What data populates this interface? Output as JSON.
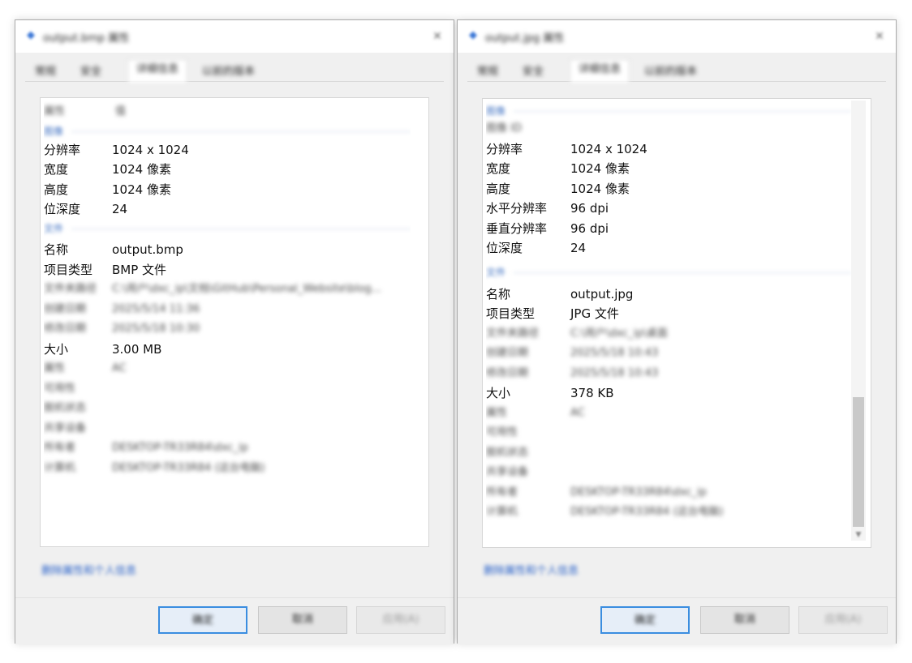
{
  "left": {
    "title": "output.bmp 属性",
    "tabs": [
      "常规",
      "安全",
      "详细信息",
      "以前的版本"
    ],
    "active_tab": 2,
    "header": {
      "key": "属性",
      "value": "值"
    },
    "section_image": "图像",
    "resolution": {
      "key": "分辨率",
      "value": "1024 x 1024"
    },
    "width": {
      "key": "宽度",
      "value": "1024 像素"
    },
    "height": {
      "key": "高度",
      "value": "1024 像素"
    },
    "bit_depth": {
      "key": "位深度",
      "value": "24"
    },
    "section_file": "文件",
    "name": {
      "key": "名称",
      "value": "output.bmp"
    },
    "item_type": {
      "key": "项目类型",
      "value": "BMP 文件"
    },
    "folder_path": {
      "key": "文件夹路径",
      "value": "C:\\用户\\dxc_ip\\文档\\GitHub\\Personal_Website\\blog..."
    },
    "created": {
      "key": "创建日期",
      "value": "2025/5/14 11:36"
    },
    "modified": {
      "key": "修改日期",
      "value": "2025/5/18 10:30"
    },
    "size": {
      "key": "大小",
      "value": "3.00 MB"
    },
    "attributes": {
      "key": "属性",
      "value": "AC"
    },
    "availability": {
      "key": "可用性",
      "value": ""
    },
    "offline_status": {
      "key": "脱机状态",
      "value": ""
    },
    "shared_with": {
      "key": "共享设备",
      "value": ""
    },
    "owner": {
      "key": "所有者",
      "value": "DESKTOP-TR33R84\\dxc_ip"
    },
    "computer": {
      "key": "计算机",
      "value": "DESKTOP-TR33R84 (这台电脑)"
    },
    "remove_link": "删除属性和个人信息",
    "buttons": {
      "ok": "确定",
      "cancel": "取消",
      "apply": "应用(A)"
    }
  },
  "right": {
    "title": "output.jpg 属性",
    "tabs": [
      "常规",
      "安全",
      "详细信息",
      "以前的版本"
    ],
    "active_tab": 2,
    "section_image": "图像",
    "image_id": {
      "key": "图像 ID",
      "value": ""
    },
    "resolution": {
      "key": "分辨率",
      "value": "1024 x 1024"
    },
    "width": {
      "key": "宽度",
      "value": "1024 像素"
    },
    "height": {
      "key": "高度",
      "value": "1024 像素"
    },
    "h_res": {
      "key": "水平分辨率",
      "value": "96 dpi"
    },
    "v_res": {
      "key": "垂直分辨率",
      "value": "96 dpi"
    },
    "bit_depth": {
      "key": "位深度",
      "value": "24"
    },
    "section_file": "文件",
    "name": {
      "key": "名称",
      "value": "output.jpg"
    },
    "item_type": {
      "key": "项目类型",
      "value": "JPG 文件"
    },
    "folder_path": {
      "key": "文件夹路径",
      "value": "C:\\用户\\dxc_ip\\桌面"
    },
    "created": {
      "key": "创建日期",
      "value": "2025/5/18 10:43"
    },
    "modified": {
      "key": "修改日期",
      "value": "2025/5/18 10:43"
    },
    "size": {
      "key": "大小",
      "value": "378 KB"
    },
    "attributes": {
      "key": "属性",
      "value": "AC"
    },
    "availability": {
      "key": "可用性",
      "value": ""
    },
    "offline_status": {
      "key": "脱机状态",
      "value": ""
    },
    "shared_with": {
      "key": "共享设备",
      "value": ""
    },
    "owner": {
      "key": "所有者",
      "value": "DESKTOP-TR33R84\\dxc_ip"
    },
    "computer": {
      "key": "计算机",
      "value": "DESKTOP-TR33R84 (这台电脑)"
    },
    "remove_link": "删除属性和个人信息",
    "buttons": {
      "ok": "确定",
      "cancel": "取消",
      "apply": "应用(A)"
    }
  },
  "icons": {
    "app": "image-file-icon",
    "close": "close-icon"
  },
  "colors": {
    "accent": "#3a8de0",
    "link": "#2a62c9",
    "section": "#3d6fc1",
    "dialog_bg": "#f0f0f0"
  }
}
